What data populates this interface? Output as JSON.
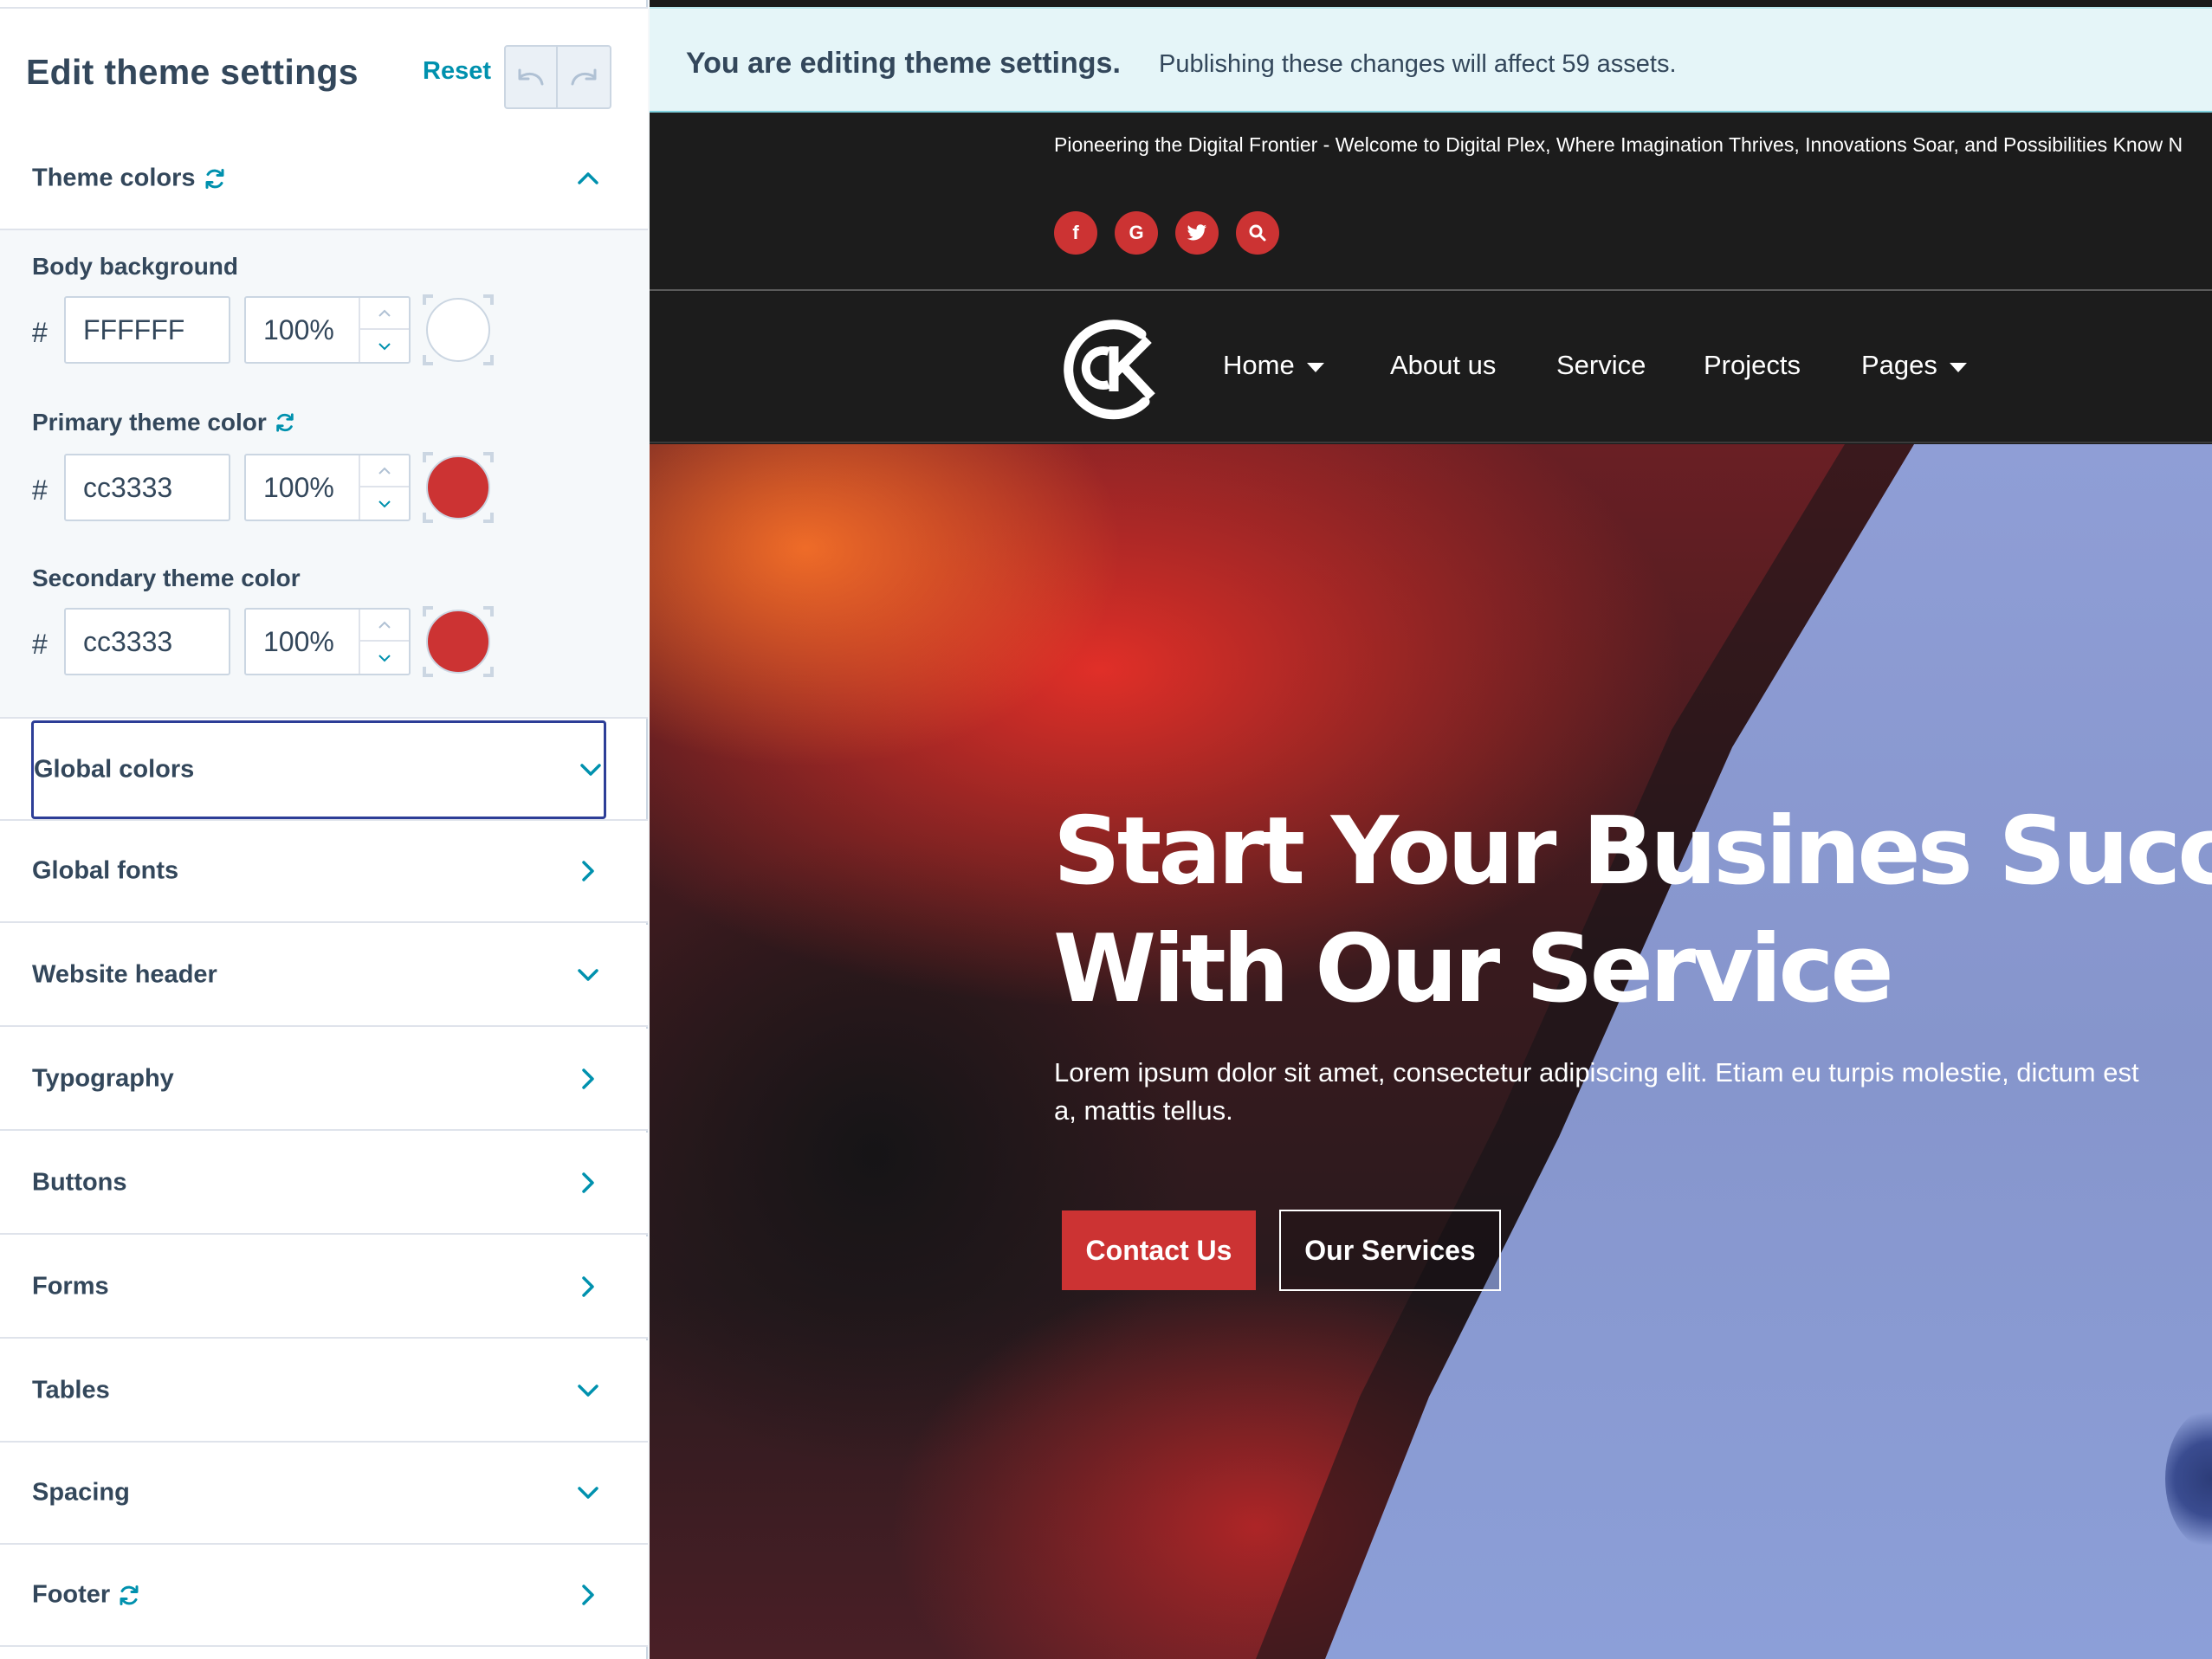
{
  "panel": {
    "title": "Edit theme settings",
    "reset_label": "Reset",
    "undo_icon": "undo-icon",
    "redo_icon": "redo-icon"
  },
  "theme_colors": {
    "label": "Theme colors",
    "expanded": true,
    "fields": [
      {
        "label": "Body background",
        "hash": "#",
        "hex": "FFFFFF",
        "opacity": "100%",
        "swatch": "#FFFFFF",
        "sync": false
      },
      {
        "label": "Primary theme color",
        "hash": "#",
        "hex": "cc3333",
        "opacity": "100%",
        "swatch": "#cc3333",
        "sync": true
      },
      {
        "label": "Secondary theme color",
        "hash": "#",
        "hex": "cc3333",
        "opacity": "100%",
        "swatch": "#cc3333",
        "sync": false
      }
    ]
  },
  "sections": [
    {
      "label": "Global colors",
      "chevron": "down",
      "focused": true
    },
    {
      "label": "Global fonts",
      "chevron": "right"
    },
    {
      "label": "Website header",
      "chevron": "down"
    },
    {
      "label": "Typography",
      "chevron": "right"
    },
    {
      "label": "Buttons",
      "chevron": "right"
    },
    {
      "label": "Forms",
      "chevron": "right"
    },
    {
      "label": "Tables",
      "chevron": "down"
    },
    {
      "label": "Spacing",
      "chevron": "down"
    },
    {
      "label": "Footer",
      "chevron": "right",
      "sync": true
    }
  ],
  "banner": {
    "strong": "You are editing theme settings.",
    "text": "Publishing these changes will affect 59 assets."
  },
  "site": {
    "tagline": "Pioneering the Digital Frontier - Welcome to Digital Plex, Where Imagination Thrives, Innovations Soar, and Possibilities Know N",
    "social": [
      {
        "icon": "facebook-icon",
        "glyph": "f"
      },
      {
        "icon": "google-icon",
        "glyph": "G"
      },
      {
        "icon": "twitter-icon",
        "glyph": "t"
      },
      {
        "icon": "search-icon",
        "glyph": ""
      }
    ],
    "logo_icon": "ck-logo-icon",
    "nav": [
      {
        "label": "Home",
        "dropdown": true
      },
      {
        "label": "About us",
        "dropdown": false
      },
      {
        "label": "Service",
        "dropdown": false
      },
      {
        "label": "Projects",
        "dropdown": false
      },
      {
        "label": "Pages",
        "dropdown": true
      }
    ],
    "hero": {
      "title_line1": "Start Your Busines Succe",
      "title_line2": "With Our Service",
      "text": "Lorem ipsum dolor sit amet, consectetur adipiscing elit. Etiam eu turpis molestie, dictum est a, mattis tellus.",
      "primary_cta": "Contact Us",
      "secondary_cta": "Our Services"
    }
  },
  "colors": {
    "accent": "#0091ae",
    "text": "#33475b",
    "brand_red": "#cc3333",
    "focus_border": "#2d3e97",
    "banner_bg": "#e5f5f8"
  }
}
